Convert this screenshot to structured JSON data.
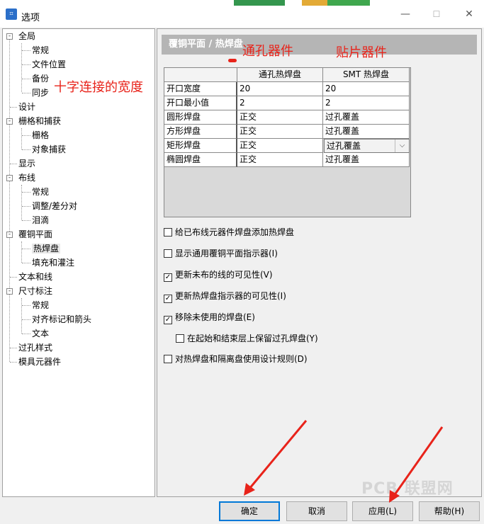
{
  "window": {
    "title": "选项"
  },
  "tree": {
    "items": [
      {
        "label": "全局",
        "level": 0,
        "expanded": true
      },
      {
        "label": "常规",
        "level": 1
      },
      {
        "label": "文件位置",
        "level": 1
      },
      {
        "label": "备份",
        "level": 1
      },
      {
        "label": "同步",
        "level": 1
      },
      {
        "label": "设计",
        "level": 0
      },
      {
        "label": "栅格和捕获",
        "level": 0,
        "expanded": true
      },
      {
        "label": "栅格",
        "level": 1
      },
      {
        "label": "对象捕获",
        "level": 1
      },
      {
        "label": "显示",
        "level": 0
      },
      {
        "label": "布线",
        "level": 0,
        "expanded": true
      },
      {
        "label": "常规",
        "level": 1
      },
      {
        "label": "调整/差分对",
        "level": 1
      },
      {
        "label": "泪滴",
        "level": 1
      },
      {
        "label": "覆铜平面",
        "level": 0,
        "expanded": true
      },
      {
        "label": "热焊盘",
        "level": 1,
        "selected": true
      },
      {
        "label": "填充和灌注",
        "level": 1
      },
      {
        "label": "文本和线",
        "level": 0
      },
      {
        "label": "尺寸标注",
        "level": 0,
        "expanded": true
      },
      {
        "label": "常规",
        "level": 1
      },
      {
        "label": "对齐标记和箭头",
        "level": 1
      },
      {
        "label": "文本",
        "level": 1
      },
      {
        "label": "过孔样式",
        "level": 0
      },
      {
        "label": "模具元器件",
        "level": 0
      }
    ]
  },
  "panel": {
    "header": "覆铜平面 / 热焊盘",
    "grid": {
      "columns": [
        "通孔热焊盘",
        "SMT 热焊盘"
      ],
      "rows": [
        {
          "label": "开口宽度",
          "through": "20",
          "smt": "20"
        },
        {
          "label": "开口最小值",
          "through": "2",
          "smt": "2"
        },
        {
          "label": "圆形焊盘",
          "through": "正交",
          "smt": "过孔覆盖"
        },
        {
          "label": "方形焊盘",
          "through": "正交",
          "smt": "过孔覆盖"
        },
        {
          "label": "矩形焊盘",
          "through": "正交",
          "smt": "过孔覆盖"
        },
        {
          "label": "椭圆焊盘",
          "through": "正交",
          "smt": "过孔覆盖"
        }
      ]
    },
    "checkboxes": [
      {
        "label": "给已布线元器件焊盘添加热焊盘",
        "checked": false
      },
      {
        "label": "显示通用覆铜平面指示器(I)",
        "checked": false
      },
      {
        "label": "更新未布的线的可见性(V)",
        "checked": true
      },
      {
        "label": "更新热焊盘指示器的可见性(I)",
        "checked": true
      },
      {
        "label": "移除未使用的焊盘(E)",
        "checked": true
      },
      {
        "label": "在起始和结束层上保留过孔焊盘(Y)",
        "checked": false
      },
      {
        "label": "对热焊盘和隔离盘使用设计规则(D)",
        "checked": false
      }
    ]
  },
  "annotations": {
    "through": "通孔器件",
    "smt": "贴片器件",
    "cross_width": "十字连接的宽度"
  },
  "buttons": {
    "ok": "确定",
    "cancel": "取消",
    "apply": "应用(L)",
    "help": "帮助(H)"
  },
  "watermark": "PCB 联盟网",
  "colors": {
    "annotation": "#e8231a",
    "focus": "#0078d7",
    "header": "#b5b5b5"
  }
}
